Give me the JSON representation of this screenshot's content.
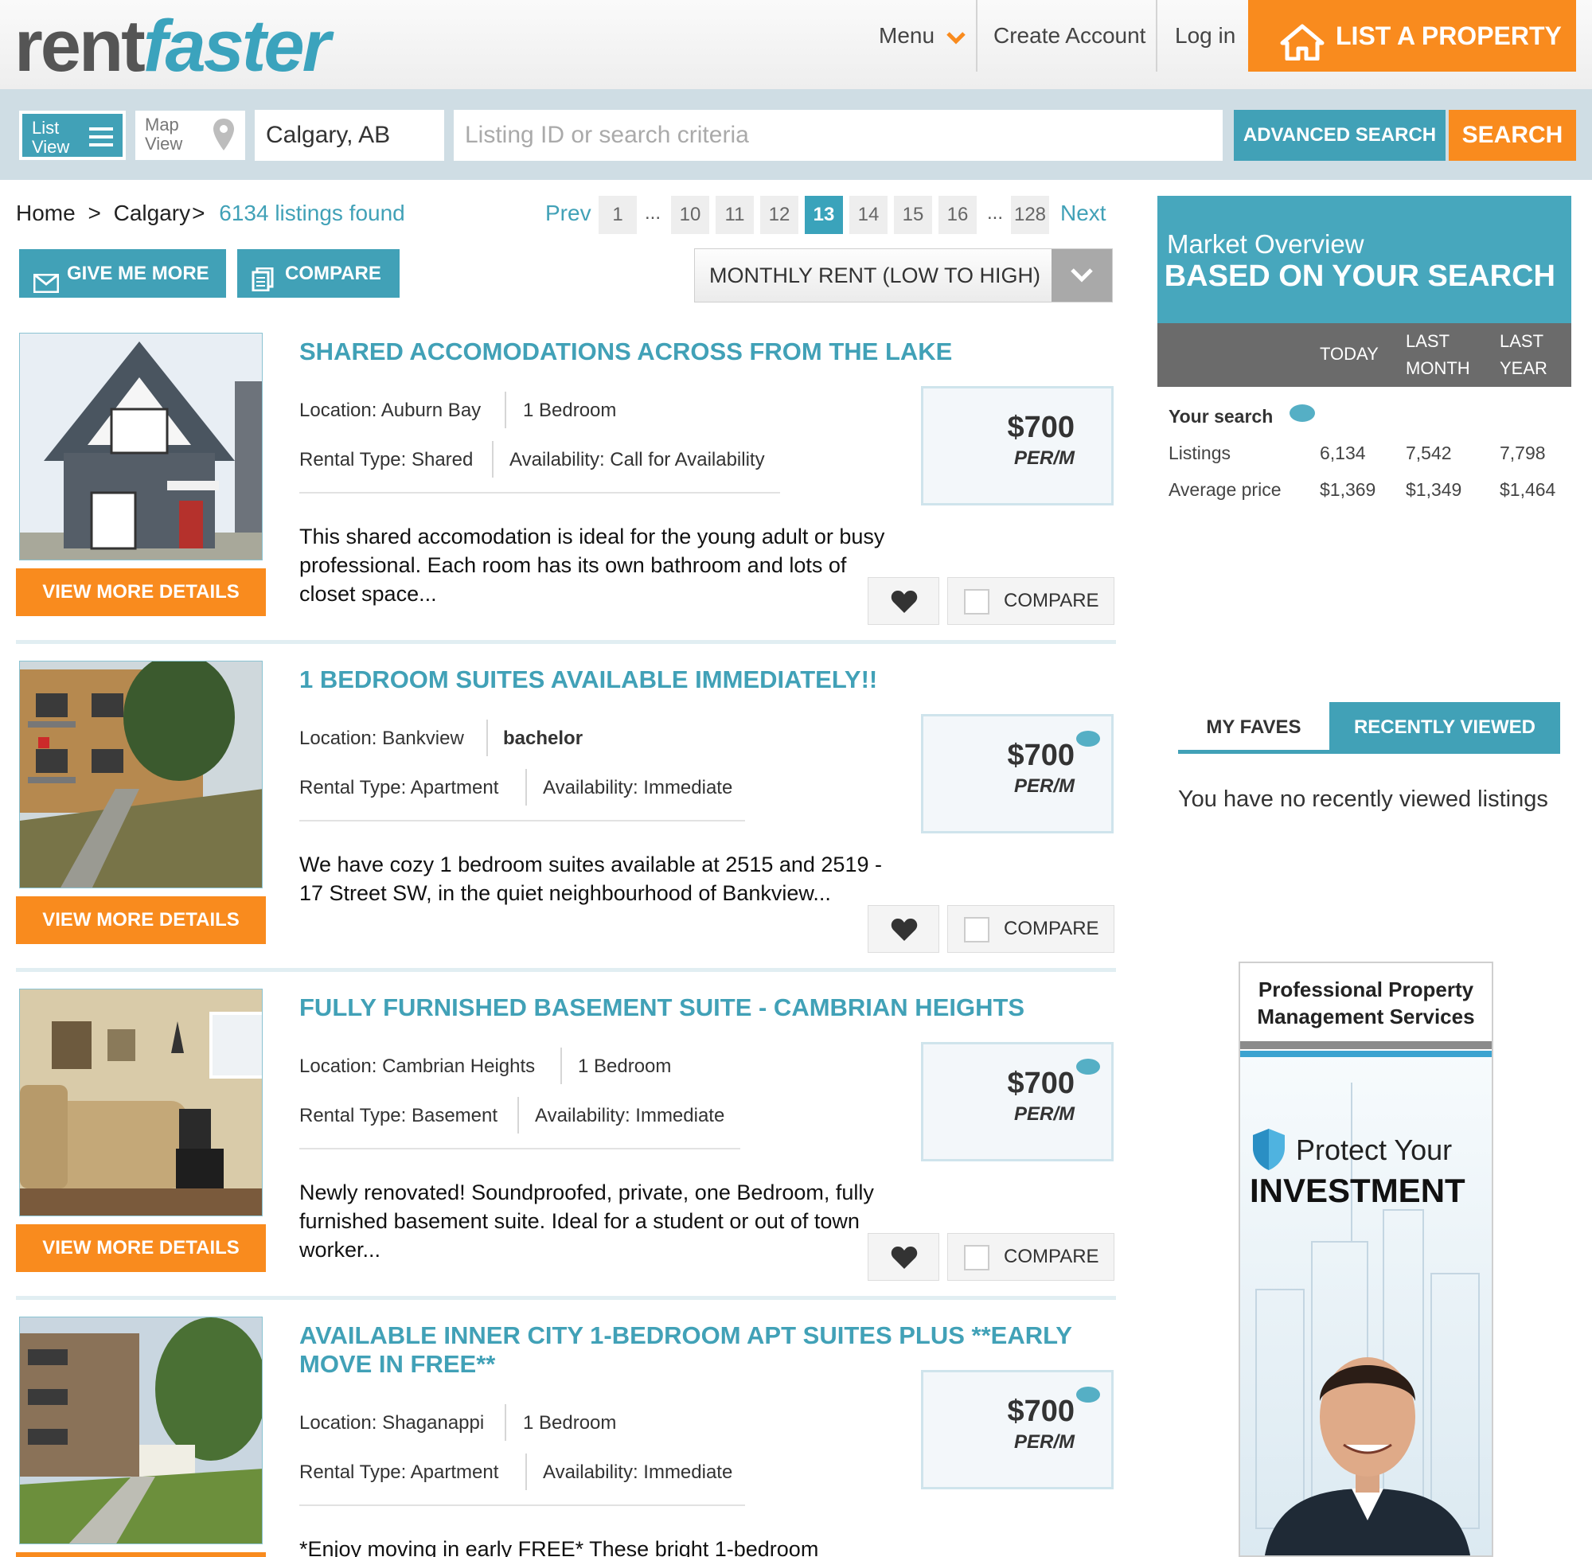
{
  "header": {
    "logo_part1": "rent",
    "logo_part2": "faster",
    "menu_label": "Menu",
    "create_account": "Create Account",
    "login": "Log in",
    "list_property": "LIST A PROPERTY"
  },
  "search": {
    "list_view_line1": "List",
    "list_view_line2": "View",
    "map_view_line1": "Map",
    "map_view_line2": "View",
    "location_value": "Calgary, AB",
    "criteria_placeholder": "Listing ID or search criteria",
    "advanced_label": "ADVANCED SEARCH",
    "search_label": "SEARCH"
  },
  "breadcrumb": {
    "home": "Home",
    "sep": ">",
    "city": "Calgary",
    "sep2": ">",
    "found": "6134 listings found"
  },
  "pagination": {
    "prev": "Prev",
    "next": "Next",
    "ellipsis": "...",
    "pages": [
      "1",
      "10",
      "11",
      "12",
      "13",
      "14",
      "15",
      "16",
      "128"
    ],
    "current": "13"
  },
  "actions": {
    "give_me_more": "GIVE ME MORE",
    "compare": "COMPARE",
    "sort_value": "MONTHLY RENT (LOW TO HIGH)"
  },
  "listings": [
    {
      "title": "SHARED ACCOMODATIONS ACROSS FROM THE LAKE",
      "location": "Location: Auburn Bay",
      "bedrooms": "1 Bedroom",
      "rental_type": "Rental Type: Shared",
      "availability": "Availability: Call for Availability",
      "desc": "This shared accomodation is ideal for the young adult or busy professional. Each room has its own bathroom and lots of closet space...",
      "price": "$700",
      "per": "PER/M",
      "details": "VIEW MORE DETAILS",
      "compare": "COMPARE"
    },
    {
      "title": "1 BEDROOM SUITES AVAILABLE IMMEDIATELY!!",
      "location": "Location: Bankview",
      "bedrooms": "bachelor",
      "rental_type": "Rental Type: Apartment",
      "availability": "Availability: Immediate",
      "desc": "We have cozy 1 bedroom suites available at 2515 and 2519 - 17 Street SW, in the quiet neighbourhood of Bankview...",
      "price": "$700",
      "per": "PER/M",
      "details": "VIEW MORE DETAILS",
      "compare": "COMPARE"
    },
    {
      "title": "FULLY FURNISHED BASEMENT SUITE - CAMBRIAN HEIGHTS",
      "location": "Location: Cambrian Heights",
      "bedrooms": "1 Bedroom",
      "rental_type": "Rental Type: Basement",
      "availability": "Availability: Immediate",
      "desc": "Newly renovated!  Soundproofed, private, one Bedroom, fully furnished basement suite.  Ideal for a student or out of town worker...",
      "price": "$700",
      "per": "PER/M",
      "details": "VIEW MORE DETAILS",
      "compare": "COMPARE"
    },
    {
      "title": "AVAILABLE INNER CITY 1-BEDROOM APT SUITES PLUS **EARLY MOVE IN FREE**",
      "location": "Location: Shaganappi",
      "bedrooms": "1 Bedroom",
      "rental_type": "Rental Type: Apartment",
      "availability": "Availability: Immediate",
      "desc": "*Enjoy moving in early FREE*  These bright 1-bedroom",
      "price": "$700",
      "per": "PER/M"
    }
  ],
  "market": {
    "title": "Market Overview",
    "subtitle": "BASED ON YOUR SEARCH",
    "col_today": "TODAY",
    "col_last_month_1": "LAST",
    "col_last_month_2": "MONTH",
    "col_last_year_1": "LAST",
    "col_last_year_2": "YEAR",
    "your_search": "Your search",
    "rows": [
      {
        "label": "Listings",
        "today": "6,134",
        "last_month": "7,542",
        "last_year": "7,798"
      },
      {
        "label": "Average price",
        "today": "$1,369",
        "last_month": "$1,349",
        "last_year": "$1,464"
      }
    ]
  },
  "tabs": {
    "faves": "MY FAVES",
    "recent": "RECENTLY VIEWED",
    "empty_message": "You have no recently viewed listings"
  },
  "ad": {
    "line1": "Professional Property",
    "line2": "Management Services",
    "protect": "Protect Your",
    "investment": "INVESTMENT"
  },
  "colors": {
    "accent_teal": "#41a1b7",
    "accent_orange": "#f98b1e"
  }
}
